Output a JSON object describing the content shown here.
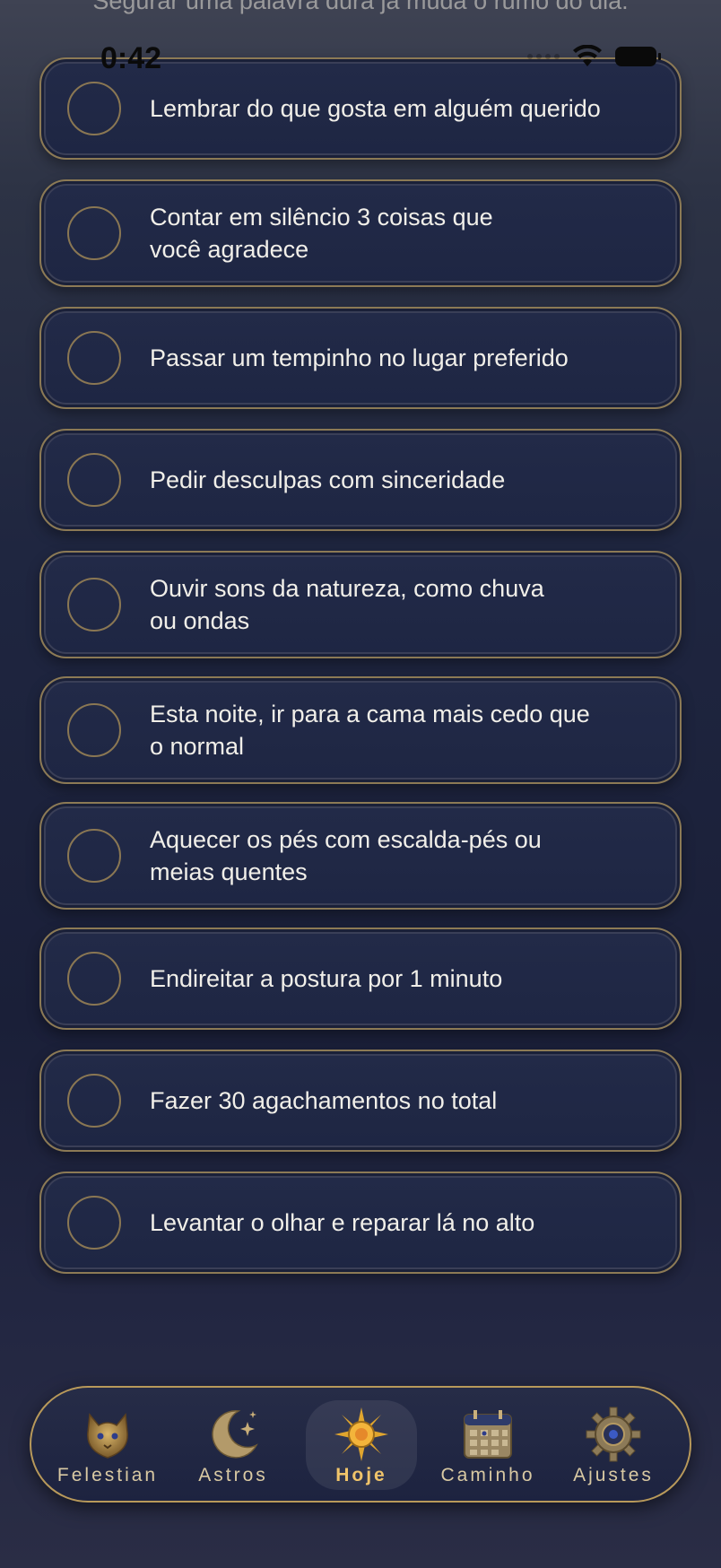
{
  "header": {
    "clipped_text": "Segurar uma palavra dura já muda o rumo do dia."
  },
  "status_bar": {
    "time": "0:42"
  },
  "tasks": [
    {
      "label": "Lembrar do que gosta em alguém querido",
      "done": false
    },
    {
      "label": "Contar em silêncio 3 coisas que\nvocê agradece",
      "done": false
    },
    {
      "label": "Passar um tempinho no lugar preferido",
      "done": false
    },
    {
      "label": "Pedir desculpas com sinceridade",
      "done": false
    },
    {
      "label": "Ouvir sons da natureza, como chuva\nou ondas",
      "done": false
    },
    {
      "label": "Esta noite, ir para a cama mais cedo que\no normal",
      "done": false
    },
    {
      "label": "Aquecer os pés com escalda-pés ou\nmeias quentes",
      "done": false
    },
    {
      "label": "Endireitar a postura por 1 minuto",
      "done": false
    },
    {
      "label": "Fazer 30 agachamentos no total",
      "done": false
    },
    {
      "label": "Levantar o olhar e reparar lá no alto",
      "done": false
    }
  ],
  "tab_bar": {
    "tabs": [
      {
        "label": "Felestian",
        "icon": "cat-emblem-icon",
        "active": false
      },
      {
        "label": "Astros",
        "icon": "crescent-moon-icon",
        "active": false
      },
      {
        "label": "Hoje",
        "icon": "sun-icon",
        "active": true
      },
      {
        "label": "Caminho",
        "icon": "calendar-icon",
        "active": false
      },
      {
        "label": "Ajustes",
        "icon": "gear-icon",
        "active": false
      }
    ]
  },
  "colors": {
    "gold_border": "#8c7a55",
    "active_tab_label": "#f0c46a",
    "card_background": "#1e2643"
  }
}
